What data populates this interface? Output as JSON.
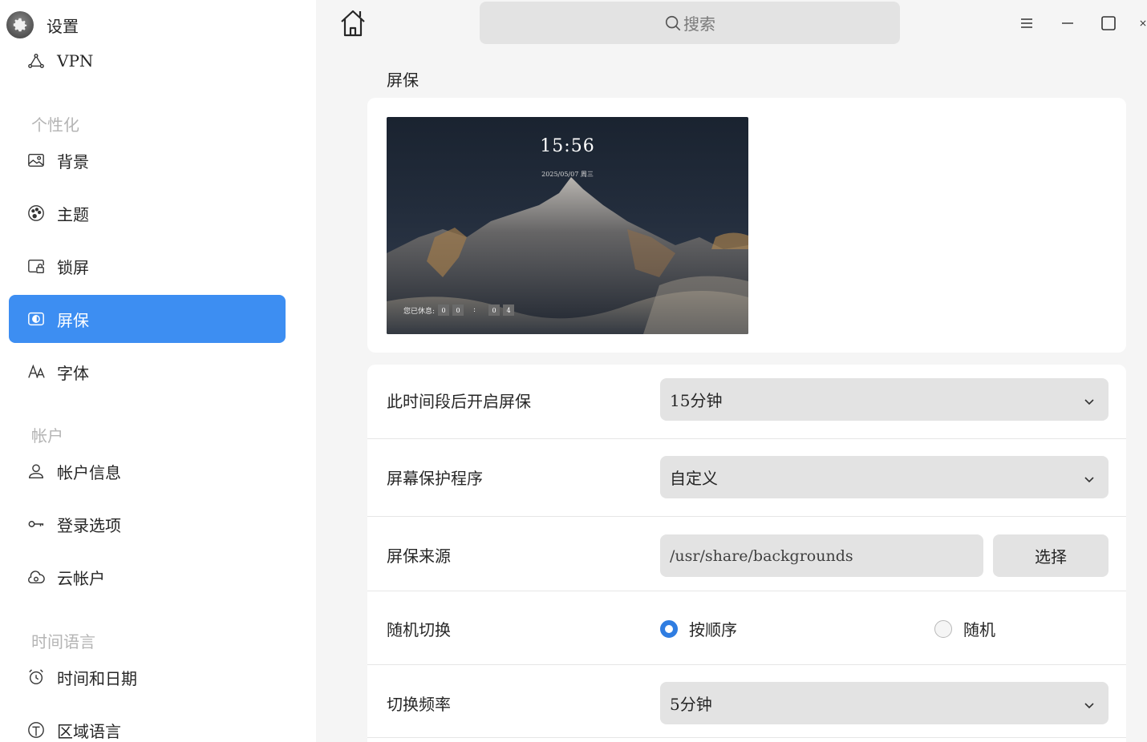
{
  "app": {
    "title": "设置"
  },
  "sidebar": {
    "items": [
      {
        "label": "VPN",
        "icon": "vpn-icon"
      },
      {
        "label": "背景",
        "icon": "image-icon"
      },
      {
        "label": "主题",
        "icon": "palette-icon"
      },
      {
        "label": "锁屏",
        "icon": "lockscreen-icon"
      },
      {
        "label": "屏保",
        "icon": "screensaver-icon",
        "active": true
      },
      {
        "label": "字体",
        "icon": "font-icon"
      },
      {
        "label": "帐户信息",
        "icon": "user-icon"
      },
      {
        "label": "登录选项",
        "icon": "key-icon"
      },
      {
        "label": "云帐户",
        "icon": "cloud-icon"
      },
      {
        "label": "时间和日期",
        "icon": "alarm-clock-icon"
      },
      {
        "label": "区域语言",
        "icon": "globe-icon"
      }
    ],
    "sections": {
      "personalization": "个性化",
      "account": "帐户",
      "time_language": "时间语言"
    }
  },
  "header": {
    "search_placeholder": "搜索"
  },
  "page": {
    "title": "屏保",
    "preview": {
      "time": "15:56",
      "date": "2025/05/07 周三",
      "rest_label": "您已休息:",
      "digits": [
        "0",
        "0",
        "0",
        "4"
      ],
      "separator": ":"
    },
    "settings": {
      "idle_label": "此时间段后开启屏保",
      "idle_value": "15分钟",
      "program_label": "屏幕保护程序",
      "program_value": "自定义",
      "source_label": "屏保来源",
      "source_path": "/usr/share/backgrounds",
      "choose_button": "选择",
      "random_label": "随机切换",
      "option_sequential": "按顺序",
      "option_random": "随机",
      "freq_label": "切换频率",
      "freq_value": "5分钟"
    }
  },
  "colors": {
    "accent": "#3d8ef2",
    "radio_on": "#2f7de1"
  }
}
